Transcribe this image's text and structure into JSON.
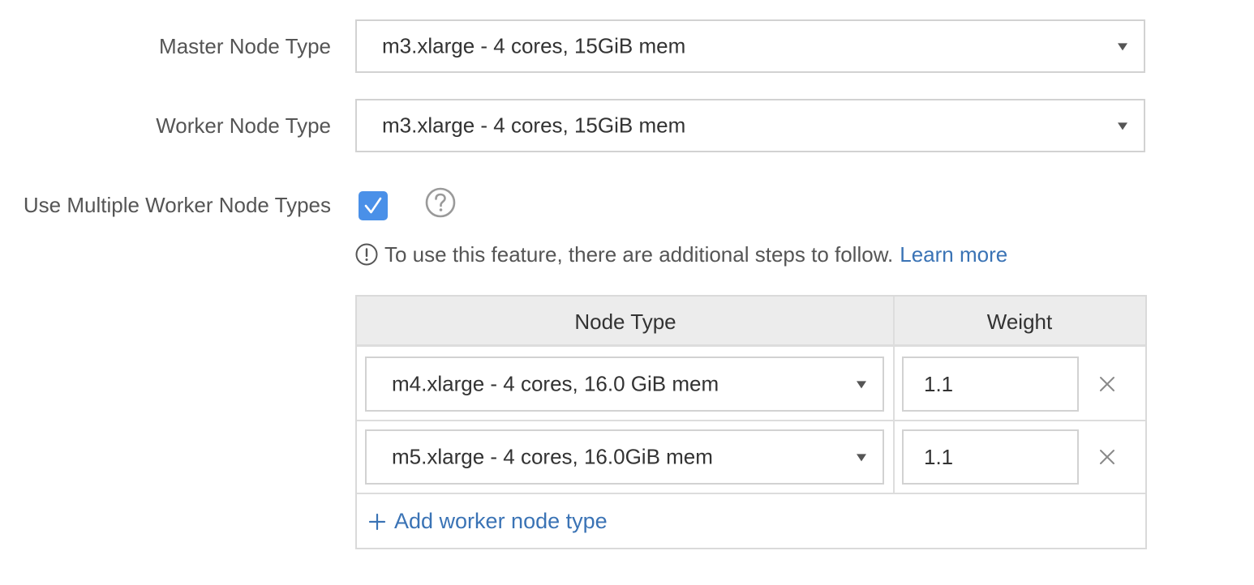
{
  "form": {
    "master_node_type": {
      "label": "Master Node Type",
      "value": "m3.xlarge - 4 cores, 15GiB mem"
    },
    "worker_node_type": {
      "label": "Worker Node Type",
      "value": "m3.xlarge - 4 cores, 15GiB mem"
    },
    "multiple_worker_types": {
      "label": "Use Multiple Worker Node Types",
      "checked": true
    },
    "notice": {
      "text": "To use this feature, there are additional steps to follow.",
      "link": "Learn more"
    },
    "worker_table": {
      "headers": {
        "node_type": "Node Type",
        "weight": "Weight"
      },
      "rows": [
        {
          "node_type": "m4.xlarge - 4 cores, 16.0 GiB mem",
          "weight": "1.1"
        },
        {
          "node_type": "m5.xlarge - 4 cores, 16.0GiB mem",
          "weight": "1.1"
        }
      ],
      "add_label": "Add worker node type"
    }
  },
  "colors": {
    "accent": "#4a90e8",
    "link": "#3a73b5",
    "header_bg": "#ececec"
  },
  "icons": [
    "chevron-down-icon",
    "checkmark-icon",
    "question-circle-icon",
    "info-circle-icon",
    "close-icon",
    "plus-icon"
  ]
}
